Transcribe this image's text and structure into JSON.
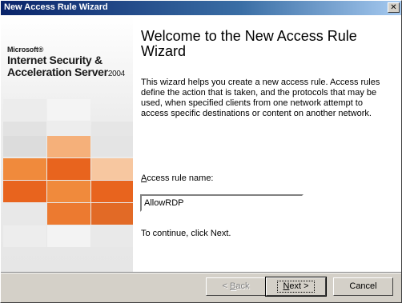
{
  "window": {
    "title": "New Access Rule Wizard",
    "close_glyph": "✕"
  },
  "branding": {
    "microsoft": "Microsoft®",
    "product_line1": "Internet Security &",
    "product_line2": "Acceleration Server",
    "product_year": "2004"
  },
  "wizard": {
    "heading": "Welcome to the New Access Rule Wizard",
    "description": "This wizard helps you create a new access rule. Access rules define the action that is taken, and the protocols that may be used, when specified clients from one network attempt to access specific destinations or content on another network.",
    "field_label_accel": "A",
    "field_label_rest": "ccess rule name:",
    "rule_name_value": "AllowRDP",
    "continue_text": "To continue, click Next."
  },
  "buttons": {
    "back_accel": "< ",
    "back_u": "B",
    "back_rest": "ack",
    "next_u": "N",
    "next_rest": "ext >",
    "cancel": "Cancel"
  },
  "colors": {
    "title_start": "#0a246a",
    "title_end": "#a6caf0",
    "orange_dark": "#e8641e",
    "orange_mid": "#f08a3c",
    "orange_light": "#f5b07a"
  }
}
